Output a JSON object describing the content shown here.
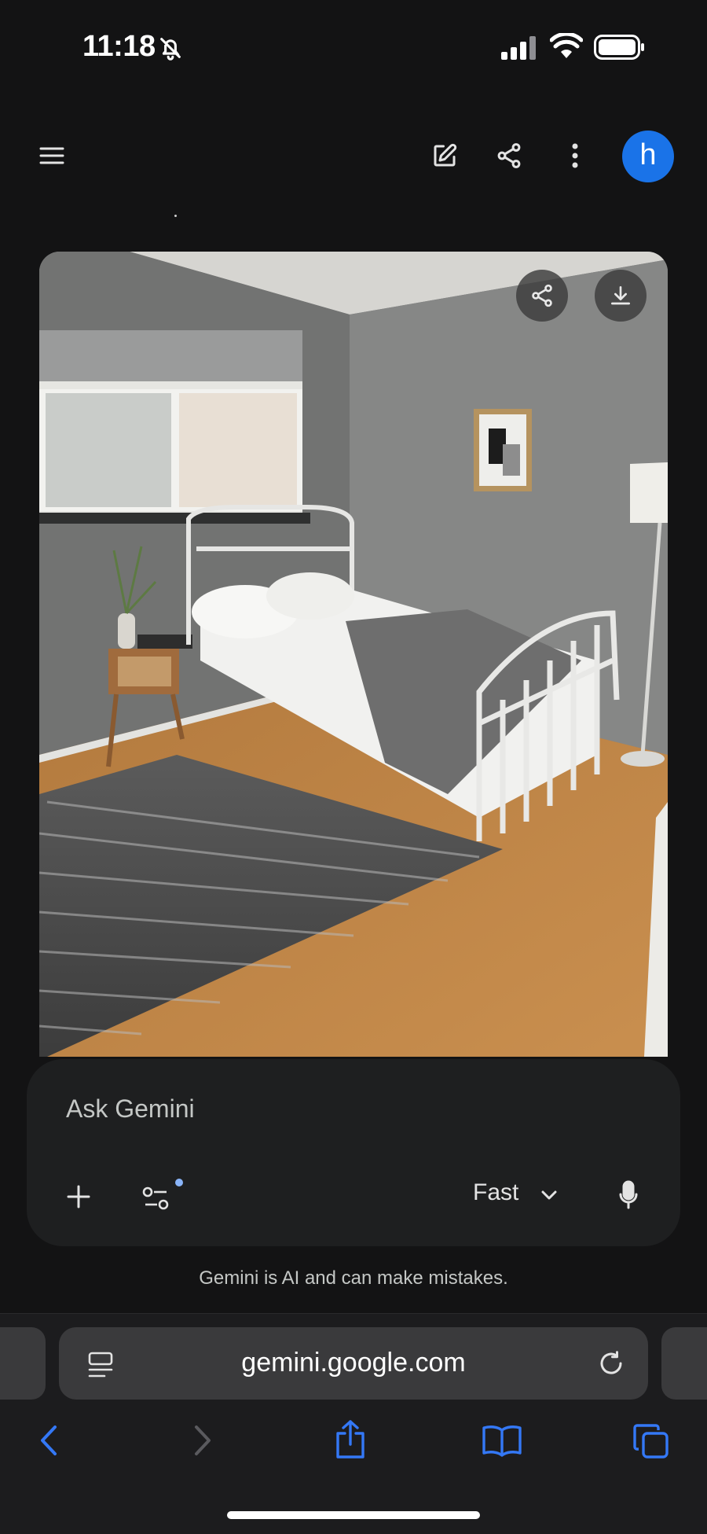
{
  "status_bar": {
    "time": "11:18",
    "icons": [
      "bell-slash-icon",
      "signal-icon",
      "wifi-icon",
      "battery-icon"
    ]
  },
  "app_bar": {
    "icons": [
      "menu-icon",
      "edit-icon",
      "share-icon",
      "more-vert-icon"
    ],
    "avatar_initial": "h"
  },
  "generated_image": {
    "overlay_icons": [
      "share-icon",
      "download-icon"
    ]
  },
  "input": {
    "placeholder": "Ask Gemini",
    "mode": "Fast",
    "icons": [
      "plus-icon",
      "tools-icon",
      "chevron-down-icon",
      "mic-icon"
    ]
  },
  "disclaimer": "Gemini is AI and can make mistakes.",
  "browser": {
    "url": "gemini.google.com",
    "icons": [
      "reader-icon",
      "reload-icon",
      "back-icon",
      "forward-icon",
      "share-icon",
      "bookmarks-icon",
      "tabs-icon"
    ]
  },
  "colors": {
    "background": "#131314",
    "surface": "#1e1f20",
    "accent_blue": "#1a73e8",
    "safari_blue": "#3478f6"
  }
}
